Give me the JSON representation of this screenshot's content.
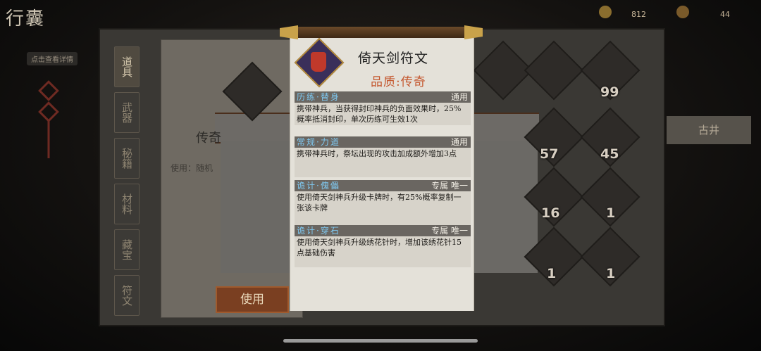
{
  "screen": {
    "title_partial": "行囊",
    "subtitle_partial": "点击查看详情"
  },
  "currency": [
    {
      "value": "812",
      "color": "#c9a248"
    },
    {
      "value": "44",
      "color": "#d08a3a"
    }
  ],
  "left_tabs": [
    "道具",
    "武器",
    "秘籍",
    "材料",
    "藏宝",
    "符文"
  ],
  "grid_counts": [
    "99",
    "57",
    "45",
    "16",
    "1",
    "1",
    "1"
  ],
  "background_detail": {
    "name": "传奇",
    "use_label": "使用：随机",
    "use_button": "使用",
    "side_label": "古井"
  },
  "popup": {
    "title": "倚天剑符文",
    "quality": "品质:传奇",
    "sections": [
      {
        "name": "历练·替身",
        "tag": "通用",
        "desc": "携带神兵，当获得封印神兵的负面效果时，25%概率抵消封印，单次历练可生效1次"
      },
      {
        "name": "常规·力道",
        "tag": "通用",
        "desc": "携带神兵时，祭坛出现的攻击加成额外增加3点"
      },
      {
        "name": "诡计·傀儡",
        "tag": "专属 唯一",
        "desc": "使用倚天剑神兵升级卡牌时，有25%概率复制一张该卡牌"
      },
      {
        "name": "诡计·穿石",
        "tag": "专属 唯一",
        "desc": "使用倚天剑神兵升级绣花针时，增加该绣花针15点基础伤害"
      }
    ]
  },
  "colors": {
    "accent_blue": "#7fc8f0",
    "quality_orange": "#c4562d",
    "button_brown": "#7a3f21"
  }
}
